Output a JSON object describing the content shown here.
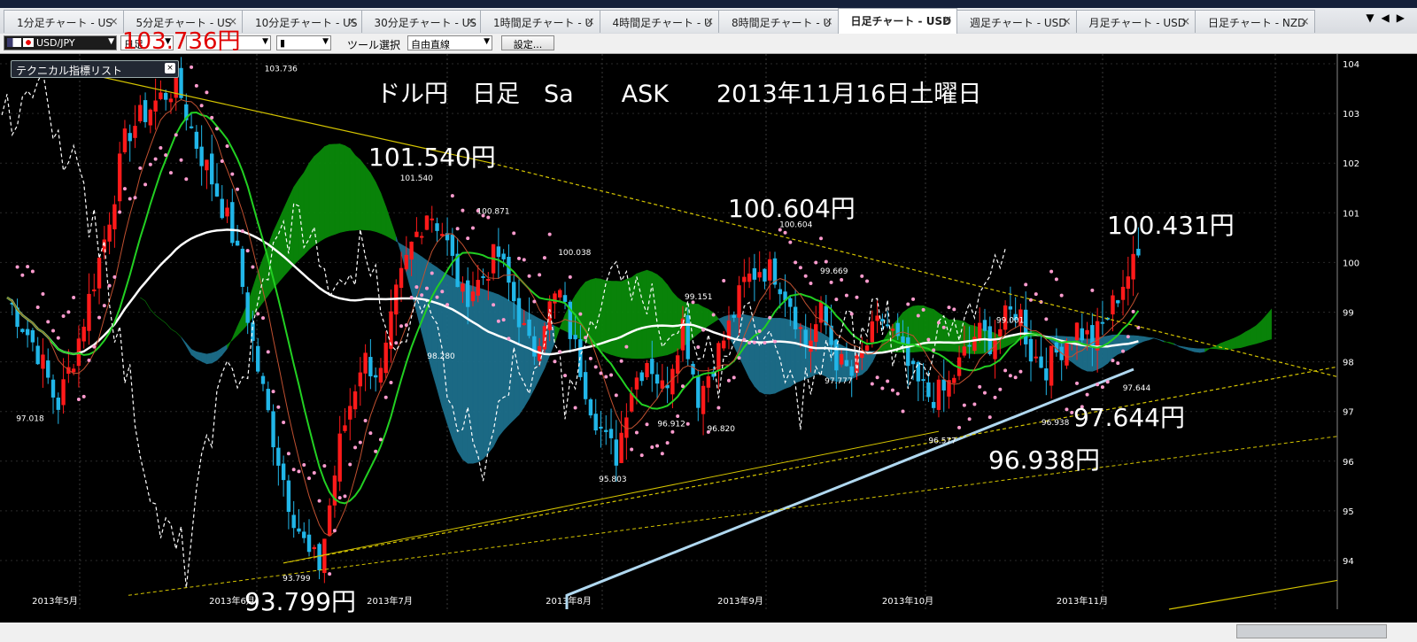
{
  "tabs": [
    {
      "label": "1分足チャート - US"
    },
    {
      "label": "5分足チャート - US"
    },
    {
      "label": "10分足チャート - US"
    },
    {
      "label": "30分足チャート - US"
    },
    {
      "label": "1時間足チャート - U"
    },
    {
      "label": "4時間足チャート - U"
    },
    {
      "label": "8時間足チャート - U"
    },
    {
      "label": "日足チャート - USD",
      "active": true
    },
    {
      "label": "週足チャート - USD"
    },
    {
      "label": "月足チャート - USD"
    },
    {
      "label": "日足チャート - NZD"
    }
  ],
  "tab_close_icon": "close-icon",
  "toolbar": {
    "symbol": "USD/JPY",
    "timeframe": "日足",
    "tool_label": "ツール選択",
    "tool_value": "自由直線",
    "settings_label": "設定..."
  },
  "high_price_label": "103.736円",
  "indicator_list_label": "テクニカル指標リスト",
  "chart_title": "ドル円　日足　Sa　　ASK　　2013年11月16日土曜日",
  "annotations": {
    "p101": "101.540円",
    "p100604": "100.604円",
    "p100431": "100.431円",
    "p97644": "97.644円",
    "p96938": "96.938円",
    "p93799": "93.799円"
  },
  "colors": {
    "bull": "#ff1a1a",
    "bear": "#21b6e8",
    "cloud_bull": "#0a8a0a",
    "cloud_bear": "#1d6f8c",
    "ma_white": "#ffffff",
    "ma_green": "#22d022",
    "ma_lightblue": "#b0d8f0",
    "sar": "#ff9ccf",
    "trend": "#d4c400"
  },
  "chart_data": {
    "type": "candlestick",
    "ylim": [
      93.3,
      104.3
    ],
    "y_ticks": [
      "104",
      "103",
      "102",
      "101",
      "100",
      "99",
      "98",
      "97",
      "96",
      "95",
      "94"
    ],
    "x_tick_labels": [
      "2013年5月",
      "2013年6月",
      "2013年7月",
      "2013年8月",
      "2013年9月",
      "2013年10月",
      "2013年11月"
    ],
    "point_labels": [
      {
        "text": "103.736",
        "x": 57,
        "y": 103.74
      },
      {
        "text": "101.540",
        "x": 87,
        "y": 101.54
      },
      {
        "text": "100.871",
        "x": 104,
        "y": 100.87
      },
      {
        "text": "100.038",
        "x": 122,
        "y": 100.04
      },
      {
        "text": "99.151",
        "x": 150,
        "y": 99.15
      },
      {
        "text": "100.604",
        "x": 171,
        "y": 100.6
      },
      {
        "text": "99.669",
        "x": 180,
        "y": 99.67
      },
      {
        "text": "99.001",
        "x": 219,
        "y": 99.0
      },
      {
        "text": "98.280",
        "x": 93,
        "y": 98.28
      },
      {
        "text": "97.018",
        "x": 2,
        "y": 97.02
      },
      {
        "text": "93.799",
        "x": 61,
        "y": 93.8
      },
      {
        "text": "95.803",
        "x": 131,
        "y": 95.8
      },
      {
        "text": "96.912",
        "x": 144,
        "y": 96.91
      },
      {
        "text": "96.820",
        "x": 155,
        "y": 96.82
      },
      {
        "text": "97.777",
        "x": 181,
        "y": 97.78
      },
      {
        "text": "96.577",
        "x": 204,
        "y": 96.58
      },
      {
        "text": "96.938",
        "x": 229,
        "y": 96.94
      },
      {
        "text": "97.644",
        "x": 247,
        "y": 97.64
      }
    ],
    "price_markers": [
      103.736,
      101.54,
      100.604,
      100.431,
      97.644,
      96.938,
      93.799
    ]
  }
}
